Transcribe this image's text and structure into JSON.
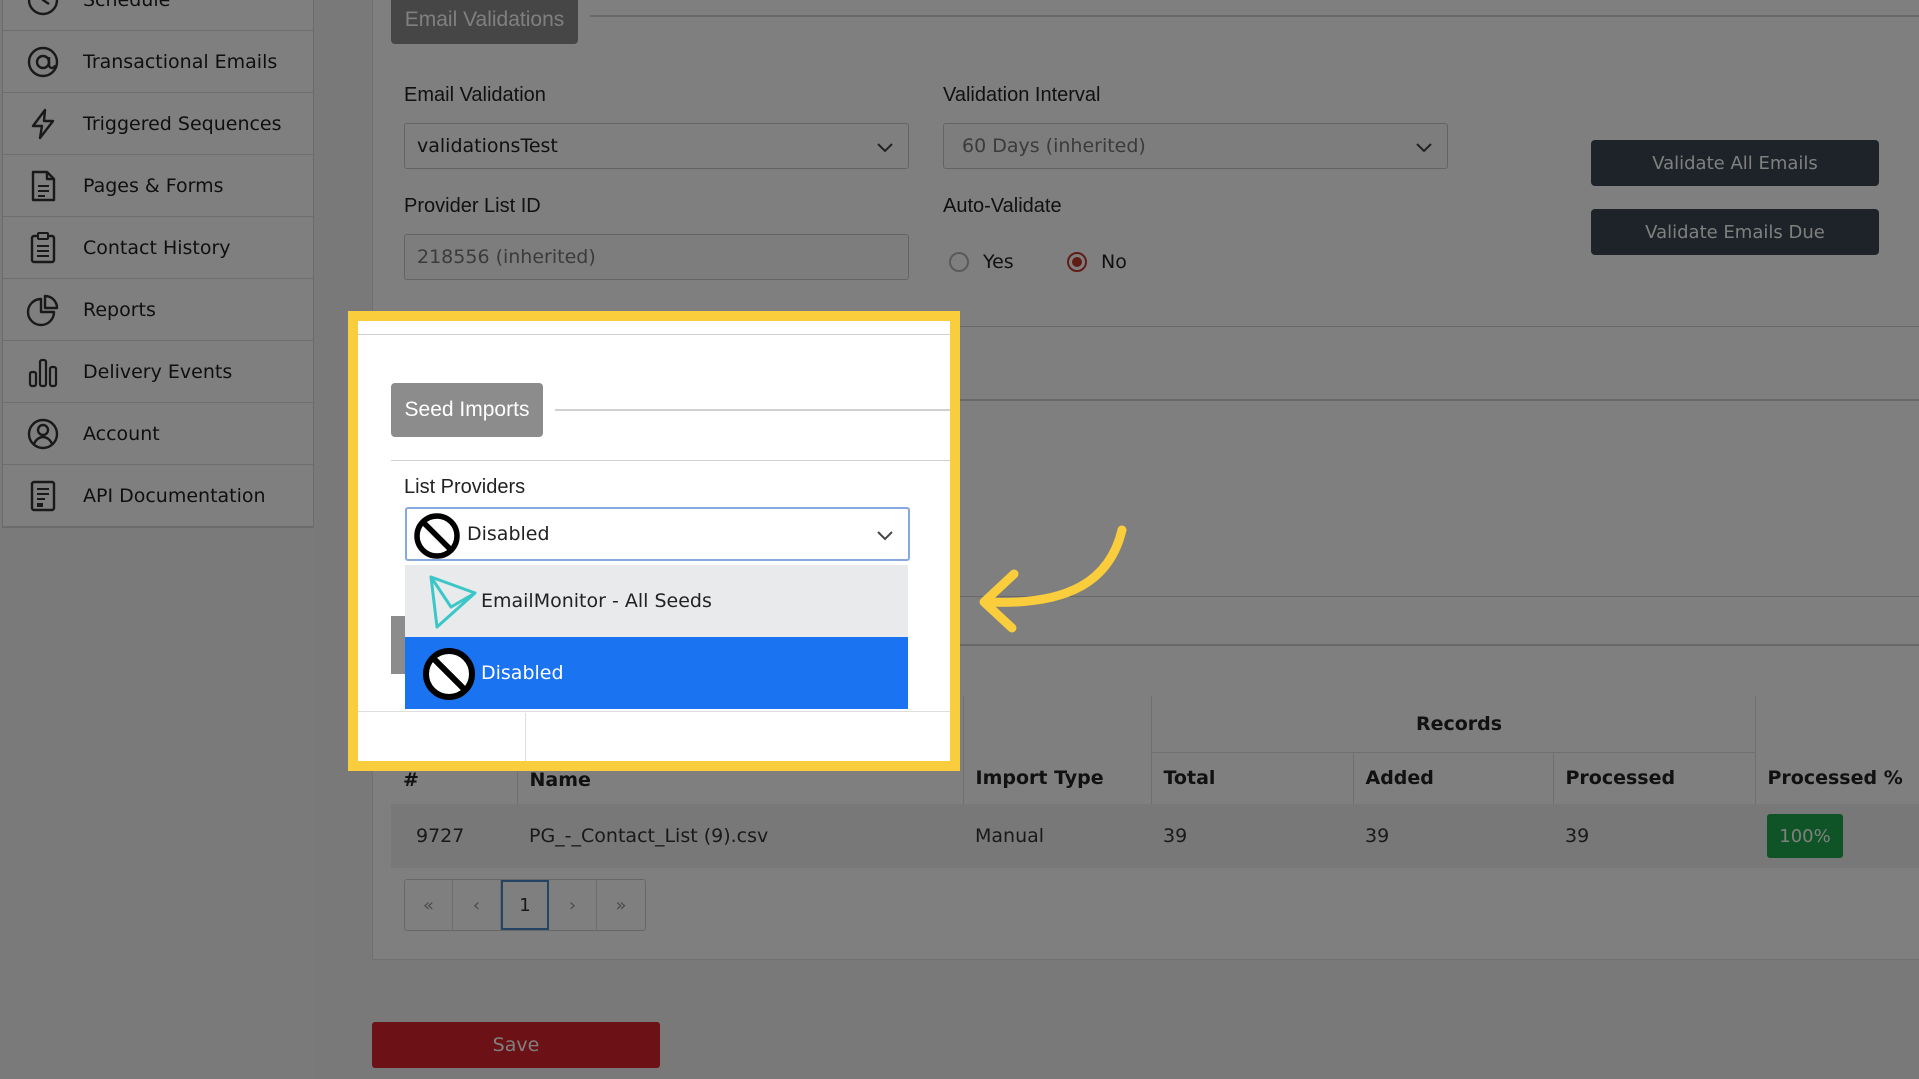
{
  "sidebar": {
    "items": [
      {
        "label": "Schedule",
        "icon": "clock-icon"
      },
      {
        "label": "Transactional Emails",
        "icon": "at-icon"
      },
      {
        "label": "Triggered Sequences",
        "icon": "lightning-icon"
      },
      {
        "label": "Pages & Forms",
        "icon": "document-icon"
      },
      {
        "label": "Contact History",
        "icon": "clipboard-icon"
      },
      {
        "label": "Reports",
        "icon": "pie-chart-icon"
      },
      {
        "label": "Delivery Events",
        "icon": "bar-chart-icon"
      },
      {
        "label": "Account",
        "icon": "user-circle-icon"
      },
      {
        "label": "API Documentation",
        "icon": "api-doc-icon"
      }
    ]
  },
  "email_validations": {
    "tab_label": "Email Validations",
    "validation_label": "Email Validation",
    "validation_value": "validationsTest",
    "interval_label": "Validation Interval",
    "interval_value": "60 Days (inherited)",
    "provider_label": "Provider List ID",
    "provider_placeholder": "218556 (inherited)",
    "auto_label": "Auto-Validate",
    "yes_label": "Yes",
    "no_label": "No",
    "validate_all": "Validate All Emails",
    "validate_due": "Validate Emails Due"
  },
  "seed_imports": {
    "tab_label": "Seed Imports",
    "list_providers_label": "List Providers",
    "selected_value": "Disabled",
    "options": [
      "EmailMonitor - All Seeds",
      "Disabled"
    ]
  },
  "table": {
    "headers": {
      "id": "#",
      "name": "Name",
      "import_type": "Import Type",
      "records": "Records",
      "total": "Total",
      "added": "Added",
      "processed": "Processed",
      "processed_pct": "Processed %"
    },
    "rows": [
      {
        "id": "9727",
        "name": "PG_-_Contact_List (9).csv",
        "import_type": "Manual",
        "total": "39",
        "added": "39",
        "processed": "39",
        "pct": "100%"
      }
    ]
  },
  "pager": {
    "first": "«",
    "prev": "‹",
    "page": "1",
    "next": "›",
    "last": "»"
  },
  "save_label": "Save",
  "colors": {
    "highlight": "#f9cd3b",
    "selected": "#1a73f0",
    "save": "#d8232a",
    "badge": "#1fa94d"
  }
}
